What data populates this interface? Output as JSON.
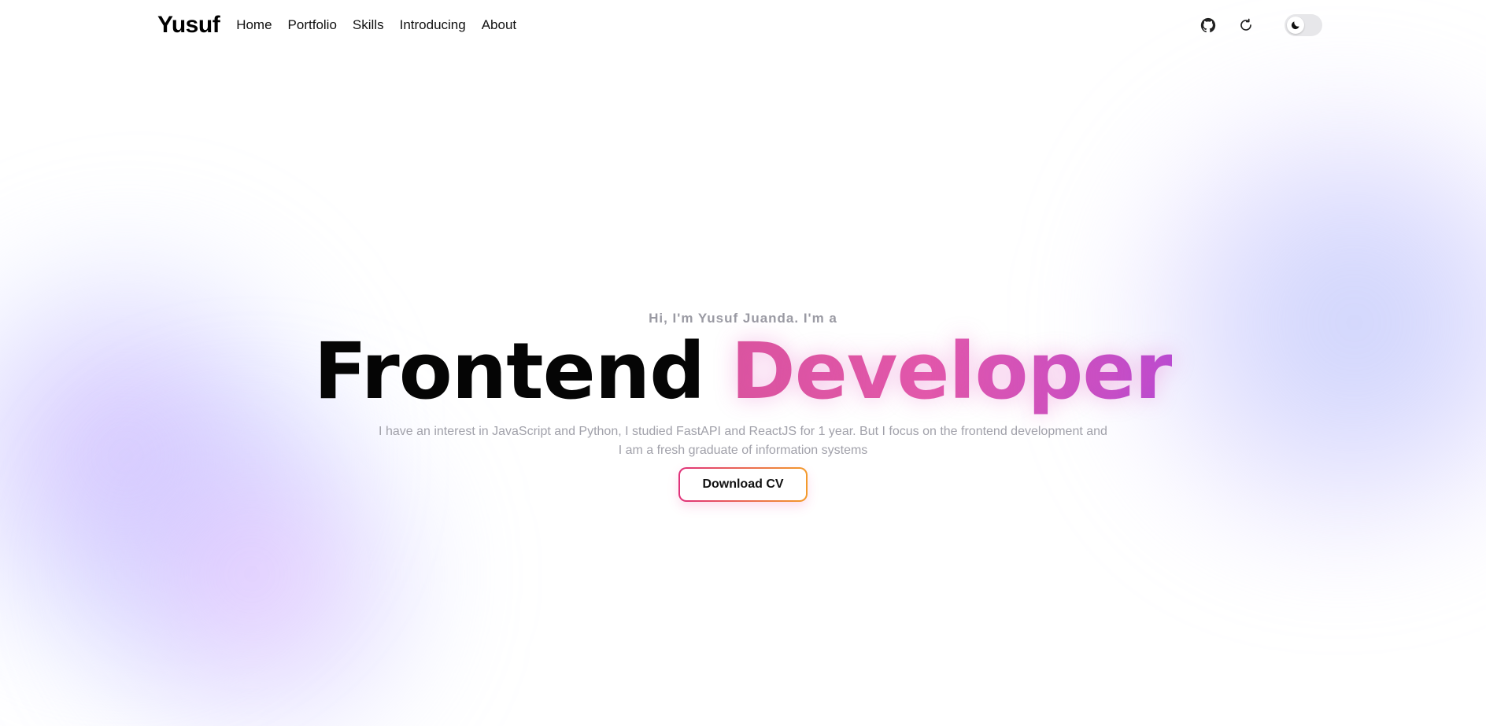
{
  "navbar": {
    "brand": "Yusuf",
    "links": [
      "Home",
      "Portfolio",
      "Skills",
      "Introducing",
      "About"
    ],
    "icons": {
      "github": "github-icon",
      "refresh": "refresh-icon",
      "theme": "moon-icon"
    }
  },
  "hero": {
    "greeting": "Hi, I'm Yusuf Juanda. I'm a",
    "role_part1": "Frontend",
    "role_part2": "Developer",
    "description_line1": "I have an interest in JavaScript and Python, I studied FastAPI and ReactJS for 1 year. But I focus on the frontend development and",
    "description_line2": "I am a fresh graduate of information systems",
    "cta_label": "Download CV"
  },
  "colors": {
    "role_gradient_start": "#d9559a",
    "role_gradient_end": "#b64bd3",
    "cta_border_start": "#e0317a",
    "cta_border_end": "#f39b2b"
  }
}
